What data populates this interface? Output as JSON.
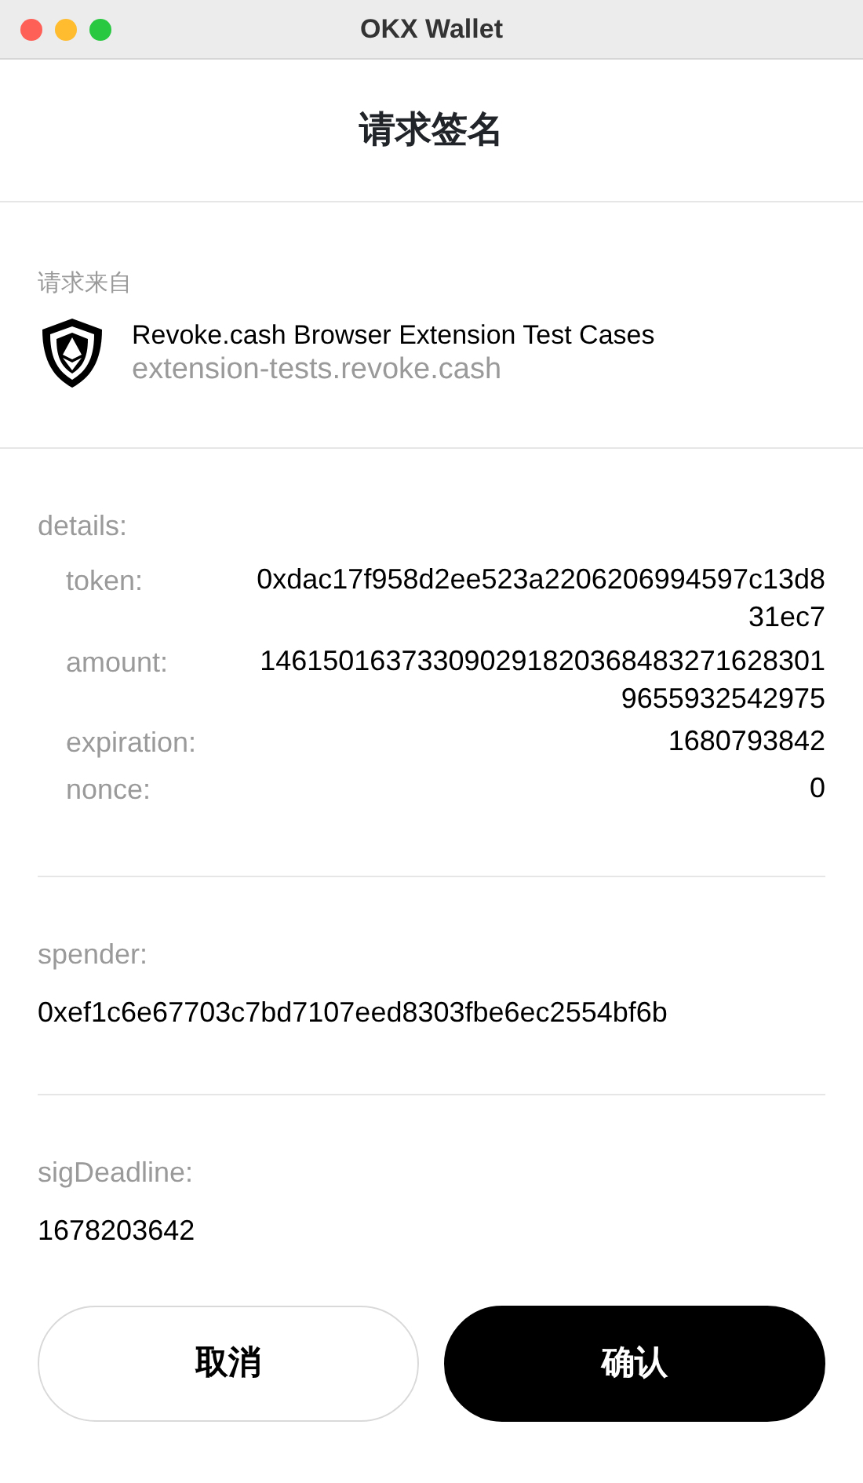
{
  "window": {
    "title": "OKX Wallet"
  },
  "header": {
    "title": "请求签名"
  },
  "origin": {
    "label": "请求来自",
    "name": "Revoke.cash Browser Extension Test Cases",
    "domain": "extension-tests.revoke.cash"
  },
  "details": {
    "label": "details:",
    "fields": [
      {
        "key": "token:",
        "value": "0xdac17f958d2ee523a2206206994597c13d831ec7"
      },
      {
        "key": "amount:",
        "value": "1461501637330902918203684832716283019655932542975"
      },
      {
        "key": "expiration:",
        "value": "1680793842"
      },
      {
        "key": "nonce:",
        "value": "0"
      }
    ]
  },
  "sections": [
    {
      "label": "spender:",
      "value": "0xef1c6e67703c7bd7107eed8303fbe6ec2554bf6b"
    },
    {
      "label": "sigDeadline:",
      "value": "1678203642"
    }
  ],
  "buttons": [
    {
      "label": "取消",
      "kind": "secondary"
    },
    {
      "label": "确认",
      "kind": "primary"
    }
  ]
}
